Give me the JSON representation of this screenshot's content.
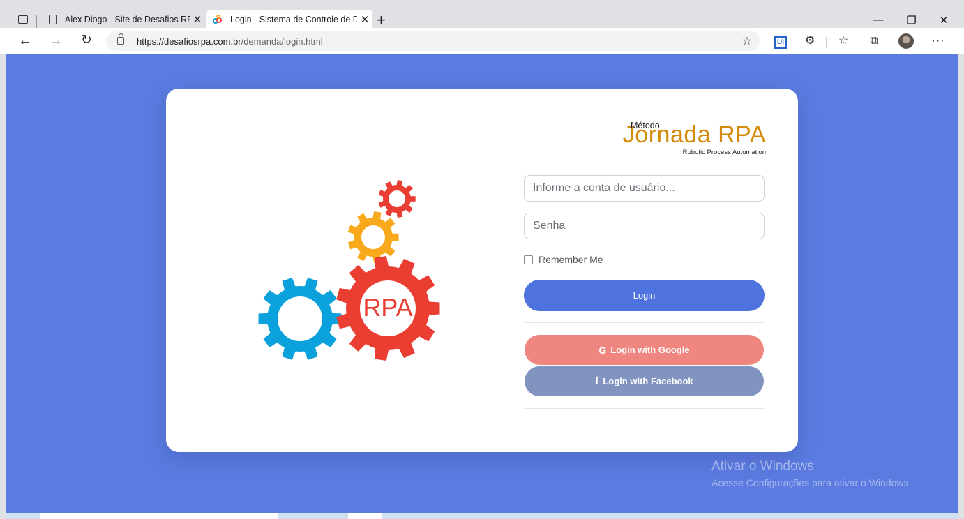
{
  "browser": {
    "tabs": [
      {
        "title": "Alex Diogo - Site de Desafios RPA",
        "active": false,
        "icon": "document-icon"
      },
      {
        "title": "Login - Sistema de Controle de Demandas",
        "active": true,
        "icon": "jornada-rpa-favicon"
      }
    ],
    "new_tab_label": "+",
    "window_buttons": {
      "minimize": "—",
      "maximize": "❐",
      "close": "✕"
    },
    "nav": {
      "back": "←",
      "forward": "→",
      "reload": "↻"
    },
    "url": {
      "base": "https://desafiosrpa.com.br",
      "path": "/demanda/login.html"
    },
    "toolbar": {
      "ui_extension": "Ui",
      "more": "···"
    }
  },
  "page": {
    "background_color": "#5b7be0",
    "brand": {
      "prefix": "Método",
      "name": "Jornada RPA",
      "tagline": "Robotic Process Automation",
      "color": "#d48b0a"
    },
    "illustration": {
      "center_label": "RPA",
      "colors": {
        "red": "#ea3e33",
        "orange": "#f8a91c",
        "blue": "#0aa1dc"
      }
    },
    "form": {
      "username_placeholder": "Informe a conta de usuário...",
      "password_placeholder": "Senha",
      "remember_label": "Remember Me",
      "remember_checked": false,
      "login_button": "Login",
      "google_icon": "G",
      "google_button": "Login with Google",
      "facebook_icon": "f",
      "facebook_button": "Login with Facebook"
    }
  },
  "watermark": {
    "title": "Ativar o Windows",
    "subtitle": "Acesse Configurações para ativar o Windows."
  }
}
